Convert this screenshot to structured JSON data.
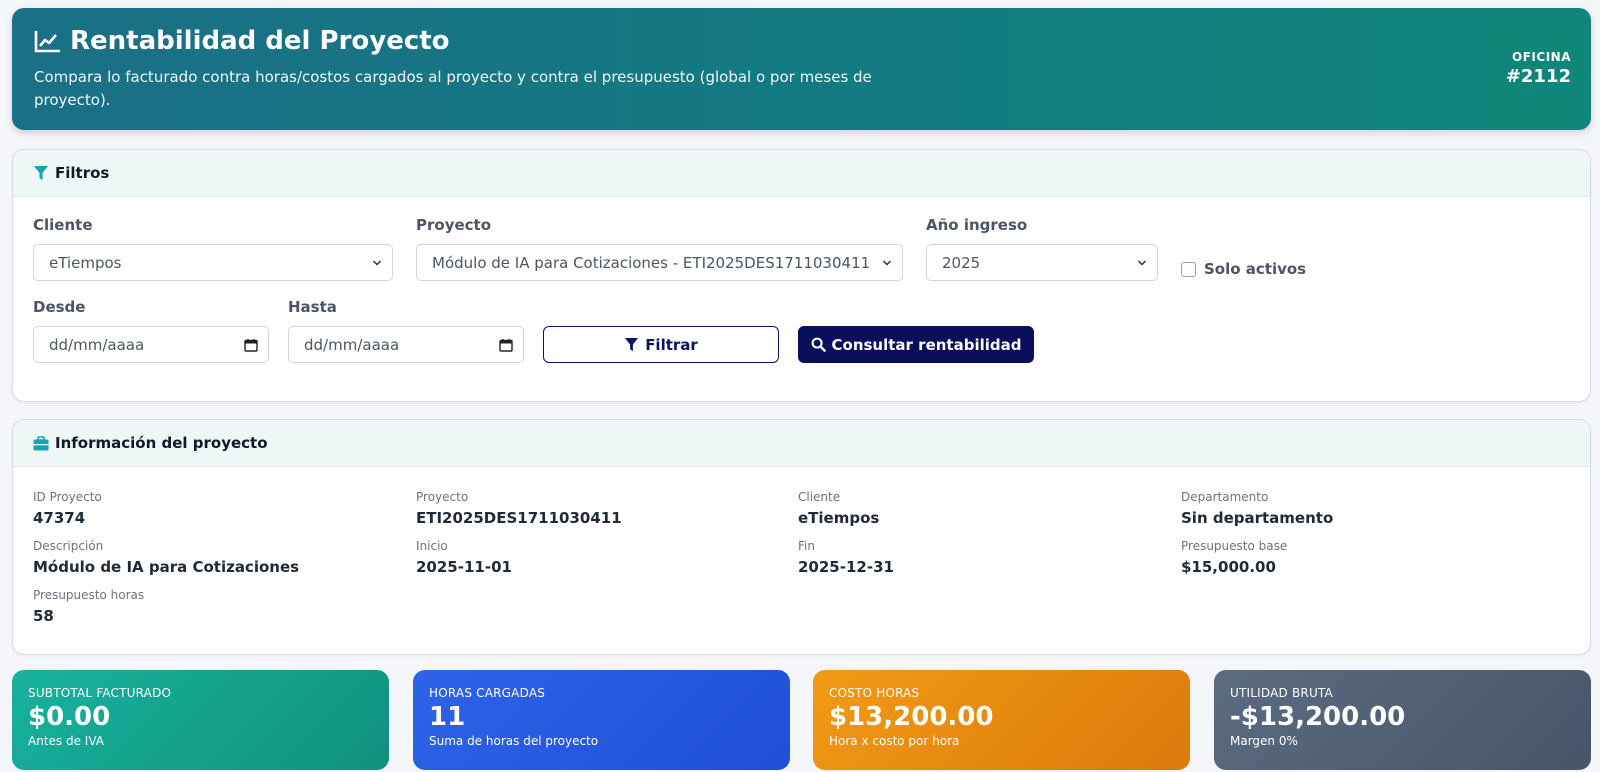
{
  "header": {
    "title": "Rentabilidad del Proyecto",
    "description": "Compara lo facturado contra horas/costos cargados al proyecto y contra el presupuesto (global o por meses de proyecto).",
    "office_label": "OFICINA",
    "office_number": "#2112"
  },
  "filters": {
    "title": "Filtros",
    "cliente_label": "Cliente",
    "cliente_value": "eTiempos",
    "proyecto_label": "Proyecto",
    "proyecto_value": "Módulo de IA para Cotizaciones - ETI2025DES1711030411",
    "anio_label": "Año ingreso",
    "anio_value": "2025",
    "solo_activos_label": "Solo activos",
    "solo_activos_checked": false,
    "desde_label": "Desde",
    "desde_placeholder": "dd/mm/aaaa",
    "hasta_label": "Hasta",
    "hasta_placeholder": "dd/mm/aaaa",
    "filtrar_label": "Filtrar",
    "consultar_label": "Consultar rentabilidad"
  },
  "info": {
    "title": "Información del proyecto",
    "id_label": "ID Proyecto",
    "id_value": "47374",
    "proyecto_label": "Proyecto",
    "proyecto_value": "ETI2025DES1711030411",
    "cliente_label": "Cliente",
    "cliente_value": "eTiempos",
    "departamento_label": "Departamento",
    "departamento_value": "Sin departamento",
    "descripcion_label": "Descripción",
    "descripcion_value": "Módulo de IA para Cotizaciones",
    "inicio_label": "Inicio",
    "inicio_value": "2025-11-01",
    "fin_label": "Fin",
    "fin_value": "2025-12-31",
    "presupuesto_base_label": "Presupuesto base",
    "presupuesto_base_value": "$15,000.00",
    "presupuesto_horas_label": "Presupuesto horas",
    "presupuesto_horas_value": "58"
  },
  "kpis": [
    {
      "label": "SUBTOTAL FACTURADO",
      "value": "$0.00",
      "sub": "Antes de IVA"
    },
    {
      "label": "HORAS CARGADAS",
      "value": "11",
      "sub": "Suma de horas del proyecto"
    },
    {
      "label": "COSTO HORAS",
      "value": "$13,200.00",
      "sub": "Hora x costo por hora"
    },
    {
      "label": "UTILIDAD BRUTA",
      "value": "-$13,200.00",
      "sub": "Margen 0%"
    }
  ],
  "colors": {
    "accent": "#0a0f5c",
    "icon_teal": "#16a3b8",
    "hero_start": "#1b6f86",
    "hero_end": "#10877a"
  }
}
